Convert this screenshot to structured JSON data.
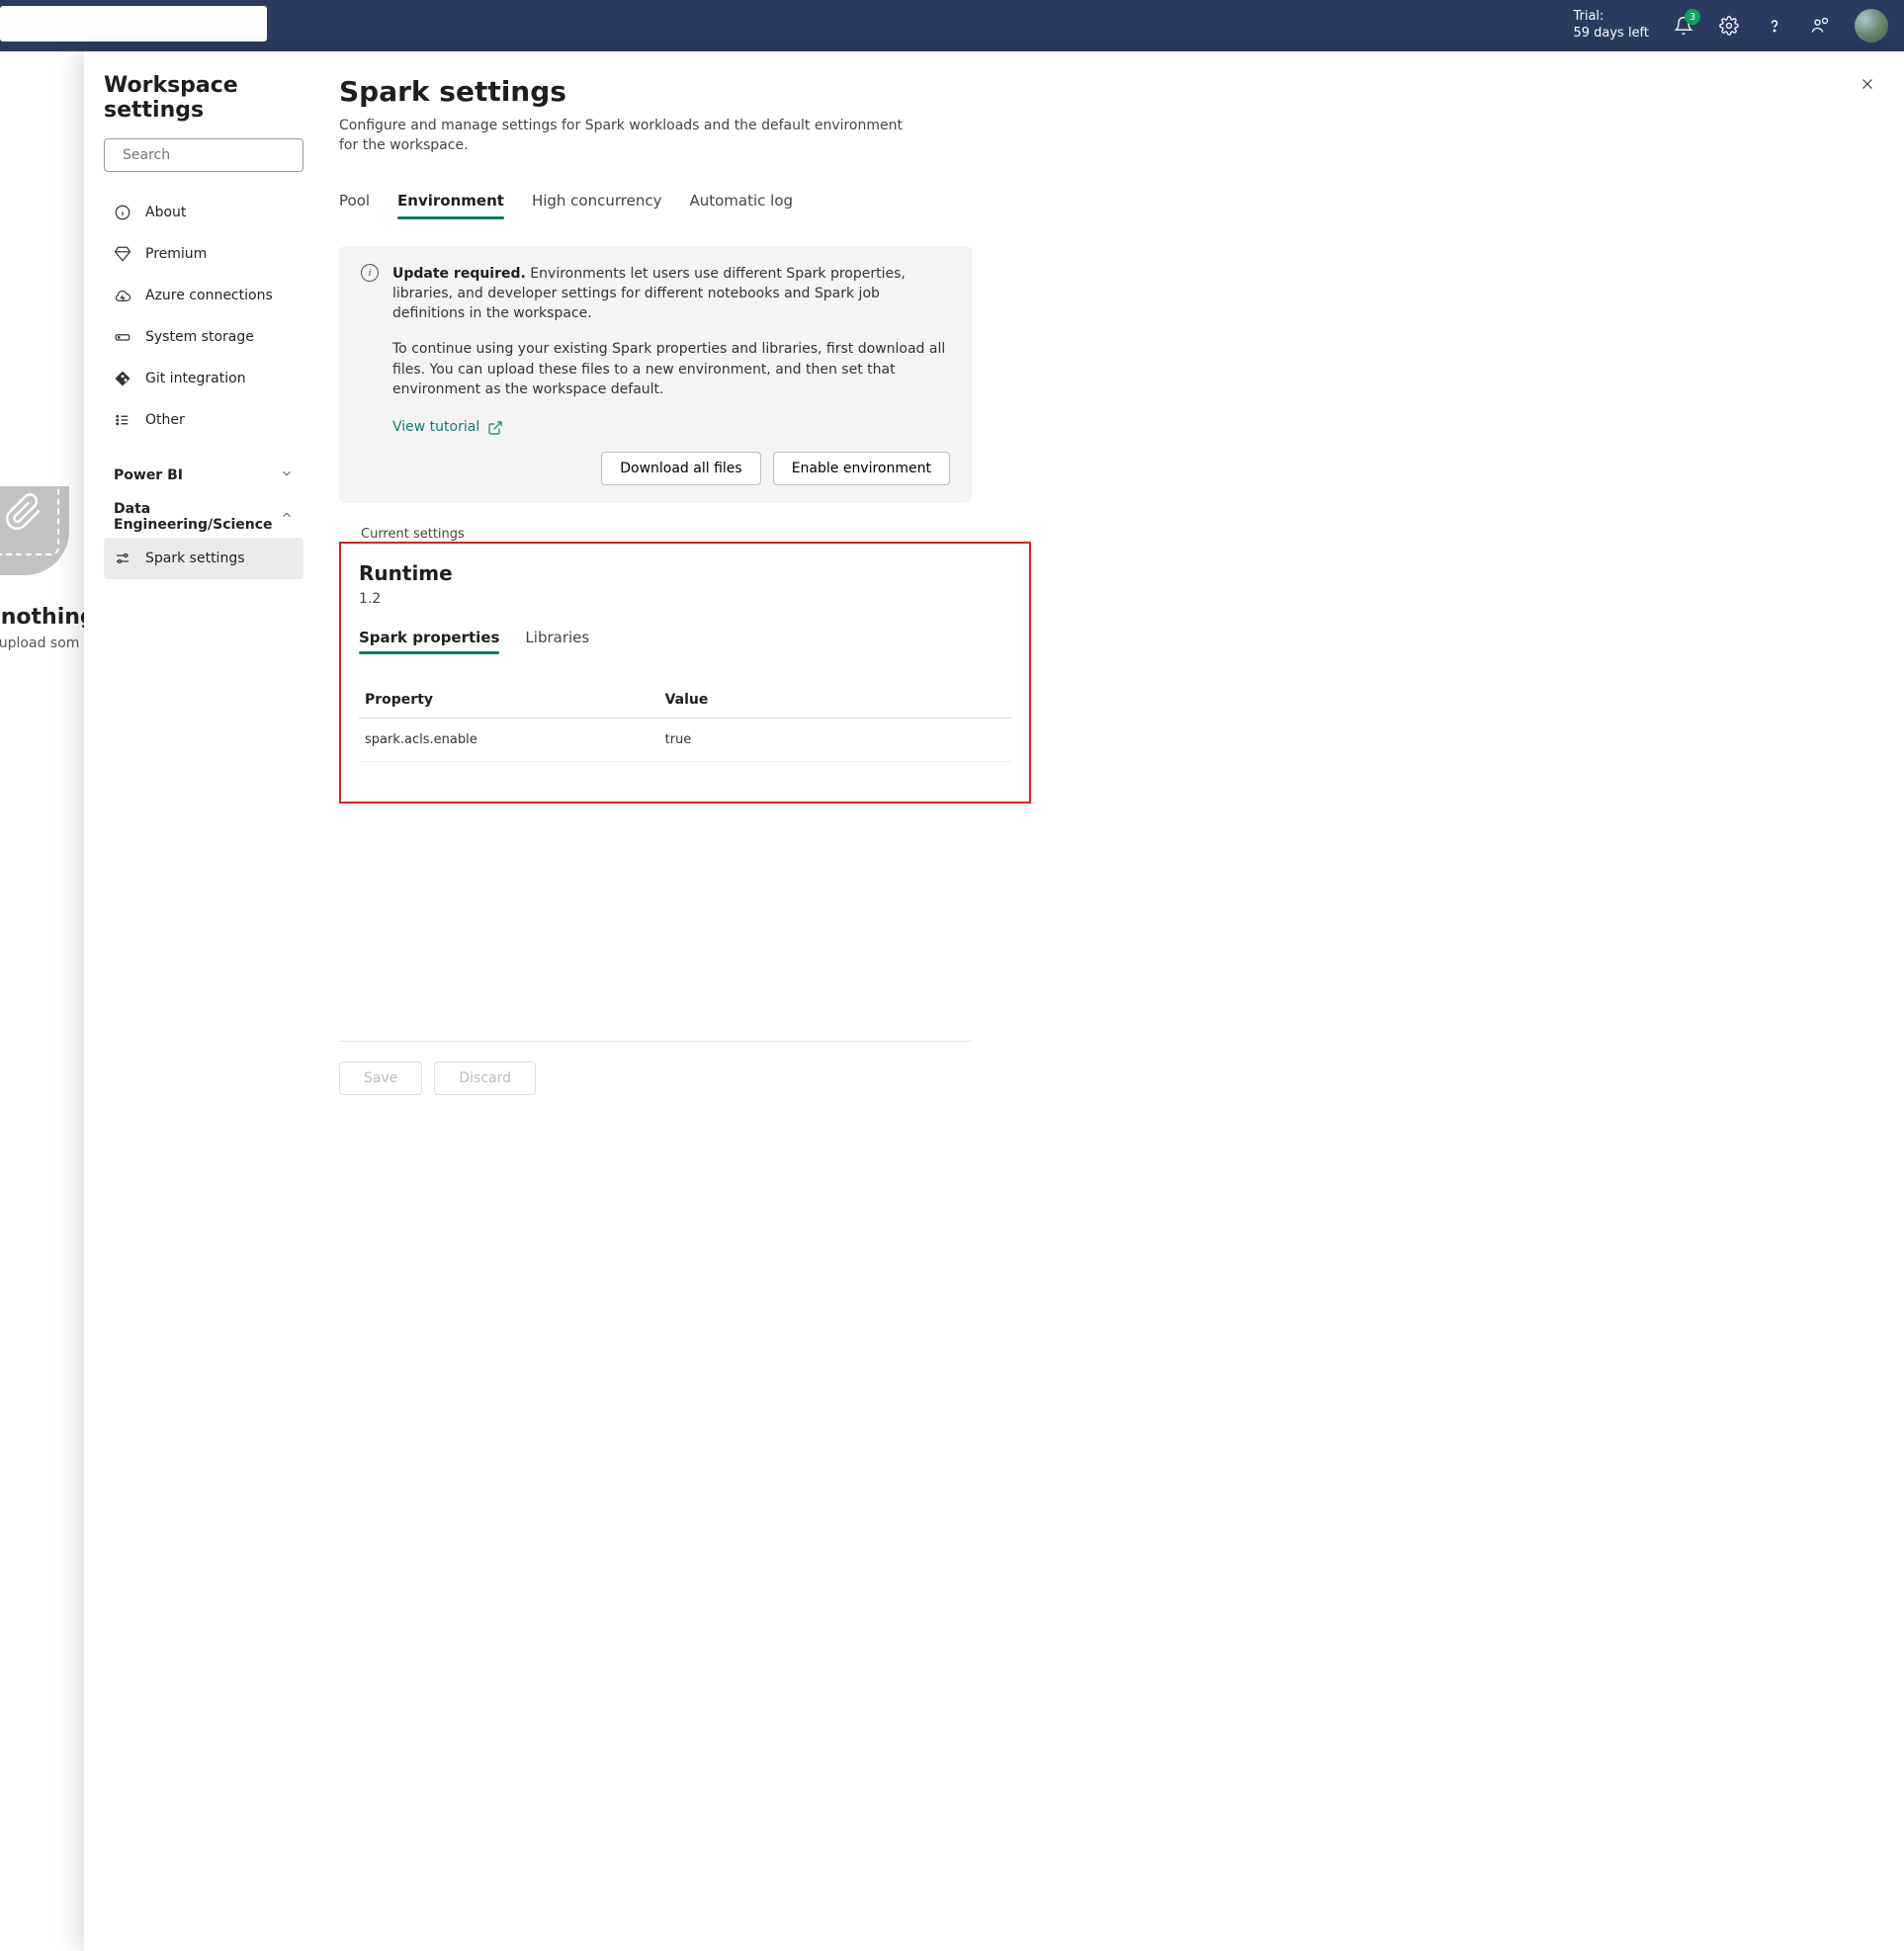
{
  "header": {
    "trial_line1": "Trial:",
    "trial_line2": "59 days left",
    "notif_badge": "3"
  },
  "backdrop": {
    "heading": "s nothing",
    "sub": "or upload som"
  },
  "panel": {
    "title": "Workspace settings",
    "search_placeholder": "Search"
  },
  "nav": {
    "items": [
      {
        "icon": "info",
        "label": "About"
      },
      {
        "icon": "diamond",
        "label": "Premium"
      },
      {
        "icon": "cloud",
        "label": "Azure connections"
      },
      {
        "icon": "storage",
        "label": "System storage"
      },
      {
        "icon": "git",
        "label": "Git integration"
      },
      {
        "icon": "other",
        "label": "Other"
      }
    ],
    "sections": {
      "powerbi": "Power BI",
      "de": "Data Engineering/Science"
    },
    "spark_settings": "Spark settings"
  },
  "main": {
    "title": "Spark settings",
    "desc": "Configure and manage settings for Spark workloads and the default environment for the workspace.",
    "tabs": [
      "Pool",
      "Environment",
      "High concurrency",
      "Automatic log"
    ],
    "info": {
      "bold": "Update required.",
      "text1": " Environments let users use different Spark properties, libraries, and developer settings for different notebooks and Spark job definitions in the workspace.",
      "text2": "To continue using your existing Spark properties and libraries, first download all files. You can upload these files to a new environment, and then set that environment as the workspace default.",
      "tutorial": "View tutorial",
      "download_btn": "Download all files",
      "enable_btn": "Enable environment"
    },
    "fieldset_label": "Current settings",
    "runtime": {
      "title": "Runtime",
      "version": "1.2",
      "subtabs": [
        "Spark properties",
        "Libraries"
      ],
      "table": {
        "col1": "Property",
        "col2": "Value",
        "rows": [
          {
            "prop": "spark.acls.enable",
            "val": "true"
          }
        ]
      }
    },
    "footer": {
      "save": "Save",
      "discard": "Discard"
    }
  }
}
